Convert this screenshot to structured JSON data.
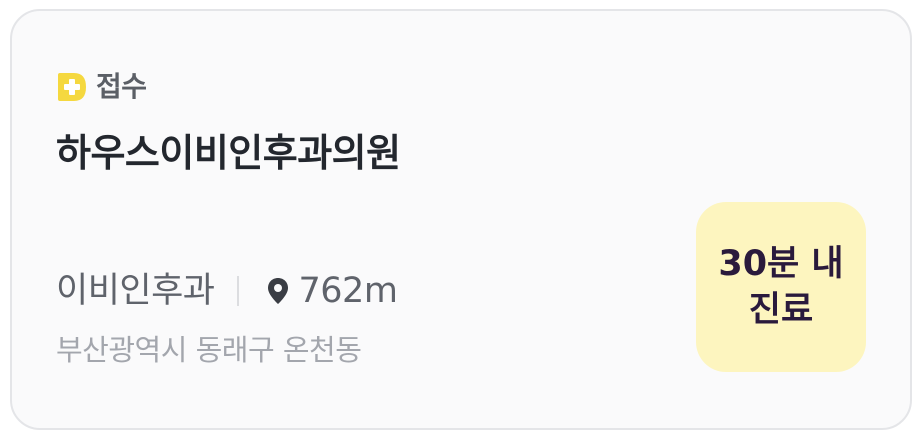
{
  "card": {
    "badge": {
      "icon": "plus-tag-icon",
      "label": "접수",
      "icon_color": "#f5d83f"
    },
    "clinic_name": "하우스이비인후과의원",
    "department": "이비인후과",
    "distance_icon": "location-pin-icon",
    "distance": "762m",
    "address": "부산광역시 동래구 온천동",
    "time_badge": {
      "text": "30분 내\n진료",
      "background": "#fdf5bf"
    }
  }
}
